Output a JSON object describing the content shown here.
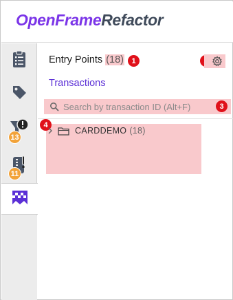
{
  "app": {
    "title_part1": "OpenFrame",
    "title_part2": "Refactor"
  },
  "activity_bar": {
    "items": [
      {
        "icon": "clipboard-list-icon"
      },
      {
        "icon": "tag-icon"
      },
      {
        "icon": "funnel-alert-icon",
        "badge": "13"
      },
      {
        "icon": "zipper-alert-icon",
        "badge": "11"
      },
      {
        "icon": "checkered-flag-icon",
        "active": true
      }
    ]
  },
  "panel": {
    "title": "Entry Points",
    "count": "(18)",
    "subtab": "Transactions",
    "search_placeholder": "Search by transaction ID (Alt+F)",
    "tree": [
      {
        "label": "CARDDEMO",
        "count": "(18)",
        "expanded": false
      }
    ]
  },
  "markers": [
    "1",
    "2",
    "3",
    "4"
  ],
  "colors": {
    "brand_purple": "#7b35e8",
    "brand_gray": "#3f4a5a",
    "link": "#5b2fd6",
    "badge_orange": "#f2a33a",
    "marker_red": "#e0111a",
    "highlight": "#f9c9cc"
  }
}
